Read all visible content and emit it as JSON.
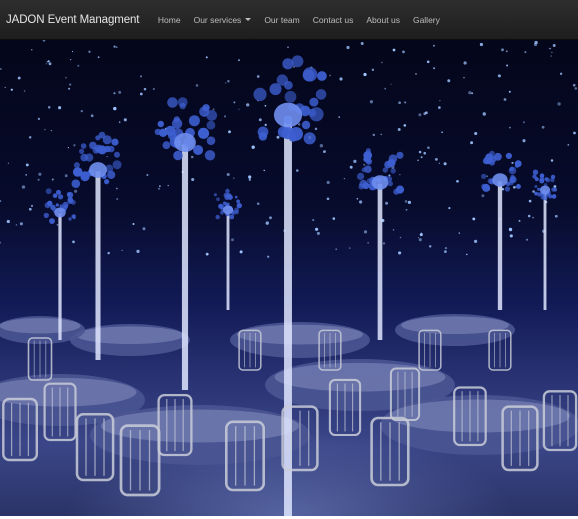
{
  "navbar": {
    "brand": "JADON Event Managment",
    "items": [
      {
        "label": "Home",
        "dropdown": false
      },
      {
        "label": "Our services",
        "dropdown": true
      },
      {
        "label": "Our team",
        "dropdown": false
      },
      {
        "label": "Contact us",
        "dropdown": false
      },
      {
        "label": "About us",
        "dropdown": false
      },
      {
        "label": "Gallery",
        "dropdown": false
      }
    ]
  },
  "hero": {
    "image": "banquet-hall-starry-backdrop",
    "colors": {
      "backdrop": "#070b2c",
      "stars": "#9fc4ff",
      "flowers": "#3d5fd1",
      "tablecloth": "#4a5592",
      "chairs": "#c9ccd8"
    }
  },
  "colors": {
    "navbar_bg": "#252525",
    "brand_text": "#e6e6e6",
    "nav_text": "#bdbdbd"
  }
}
